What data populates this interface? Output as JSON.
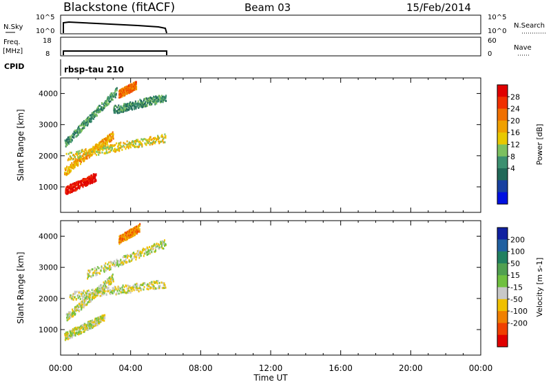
{
  "header": {
    "station": "Blackstone (fitACF)",
    "beam": "Beam 03",
    "date": "15/Feb/2014"
  },
  "sky_panel": {
    "left_label": "N.Sky",
    "left_ticks": [
      "10^5",
      "10^0"
    ],
    "right_label": "N.Search",
    "right_ticks": [
      "10^5",
      "10^0"
    ]
  },
  "freq_panel": {
    "left_label": "Freq.",
    "left_unit": "[MHz]",
    "left_ticks": [
      "18",
      "8"
    ],
    "right_label": "Nave",
    "right_ticks": [
      "60",
      "0"
    ]
  },
  "cpid_panel": {
    "label": "CPID",
    "value": "rbsp-tau 210"
  },
  "chart_data": [
    {
      "type": "heatmap",
      "quantity": "Power",
      "ylabel": "Slant Range [km]",
      "ylim": [
        180,
        4500
      ],
      "yticks": [
        1000,
        2000,
        3000,
        4000
      ],
      "xlim_hours": [
        0,
        24
      ],
      "data_extent_hours": [
        0,
        6
      ],
      "colorbar": {
        "label": "Power [dB]",
        "ticks": [
          "28",
          "24",
          "20",
          "16",
          "12",
          "8",
          "4"
        ],
        "colors": [
          "#e00000",
          "#f03000",
          "#f07000",
          "#f0a000",
          "#e8c800",
          "#7cc060",
          "#3c9070",
          "#206858",
          "#1840a0",
          "#0010e0"
        ]
      },
      "bands": [
        {
          "t0": 0.25,
          "r0": 900,
          "t1": 2.0,
          "r1": 1350,
          "level": 0
        },
        {
          "t0": 0.2,
          "r0": 1500,
          "t1": 3.0,
          "r1": 2700,
          "level": 3
        },
        {
          "t0": 0.3,
          "r0": 2000,
          "t1": 6.0,
          "r1": 2600,
          "level": 4
        },
        {
          "t0": 0.2,
          "r0": 2400,
          "t1": 3.2,
          "r1": 4100,
          "level": 6
        },
        {
          "t0": 3.0,
          "r0": 3500,
          "t1": 6.0,
          "r1": 3900,
          "level": 6
        },
        {
          "t0": 3.3,
          "r0": 4000,
          "t1": 4.3,
          "r1": 4300,
          "level": 2
        }
      ]
    },
    {
      "type": "heatmap",
      "quantity": "Velocity",
      "ylabel": "Slant Range [km]",
      "ylim": [
        180,
        4500
      ],
      "yticks": [
        1000,
        2000,
        3000,
        4000
      ],
      "xlim_hours": [
        0,
        24
      ],
      "data_extent_hours": [
        0,
        6
      ],
      "colorbar": {
        "label": "Velocity [m s-1]",
        "ticks": [
          "200",
          "100",
          "50",
          "15",
          "-15",
          "-50",
          "-100",
          "-200"
        ],
        "colors": [
          "#1020a0",
          "#2060a0",
          "#208060",
          "#50a050",
          "#70c040",
          "#c8c8c8",
          "#f0c000",
          "#f08000",
          "#f04000",
          "#e00000"
        ]
      },
      "bands": [
        {
          "t0": 0.2,
          "r0": 800,
          "t1": 2.5,
          "r1": 1400,
          "level": 5
        },
        {
          "t0": 0.3,
          "r0": 1400,
          "t1": 3.0,
          "r1": 2700,
          "level": 5
        },
        {
          "t0": 0.5,
          "r0": 2100,
          "t1": 6.0,
          "r1": 2500,
          "level": 5
        },
        {
          "t0": 1.5,
          "r0": 2800,
          "t1": 6.0,
          "r1": 3800,
          "level": 5
        },
        {
          "t0": 3.3,
          "r0": 3900,
          "t1": 4.5,
          "r1": 4300,
          "level": 7
        }
      ]
    }
  ],
  "time_axis": {
    "ticks": [
      "00:00",
      "04:00",
      "08:00",
      "12:00",
      "16:00",
      "20:00",
      "00:00"
    ],
    "label": "Time UT"
  },
  "colors": {
    "ink": "#000000",
    "background": "#ffffff"
  }
}
